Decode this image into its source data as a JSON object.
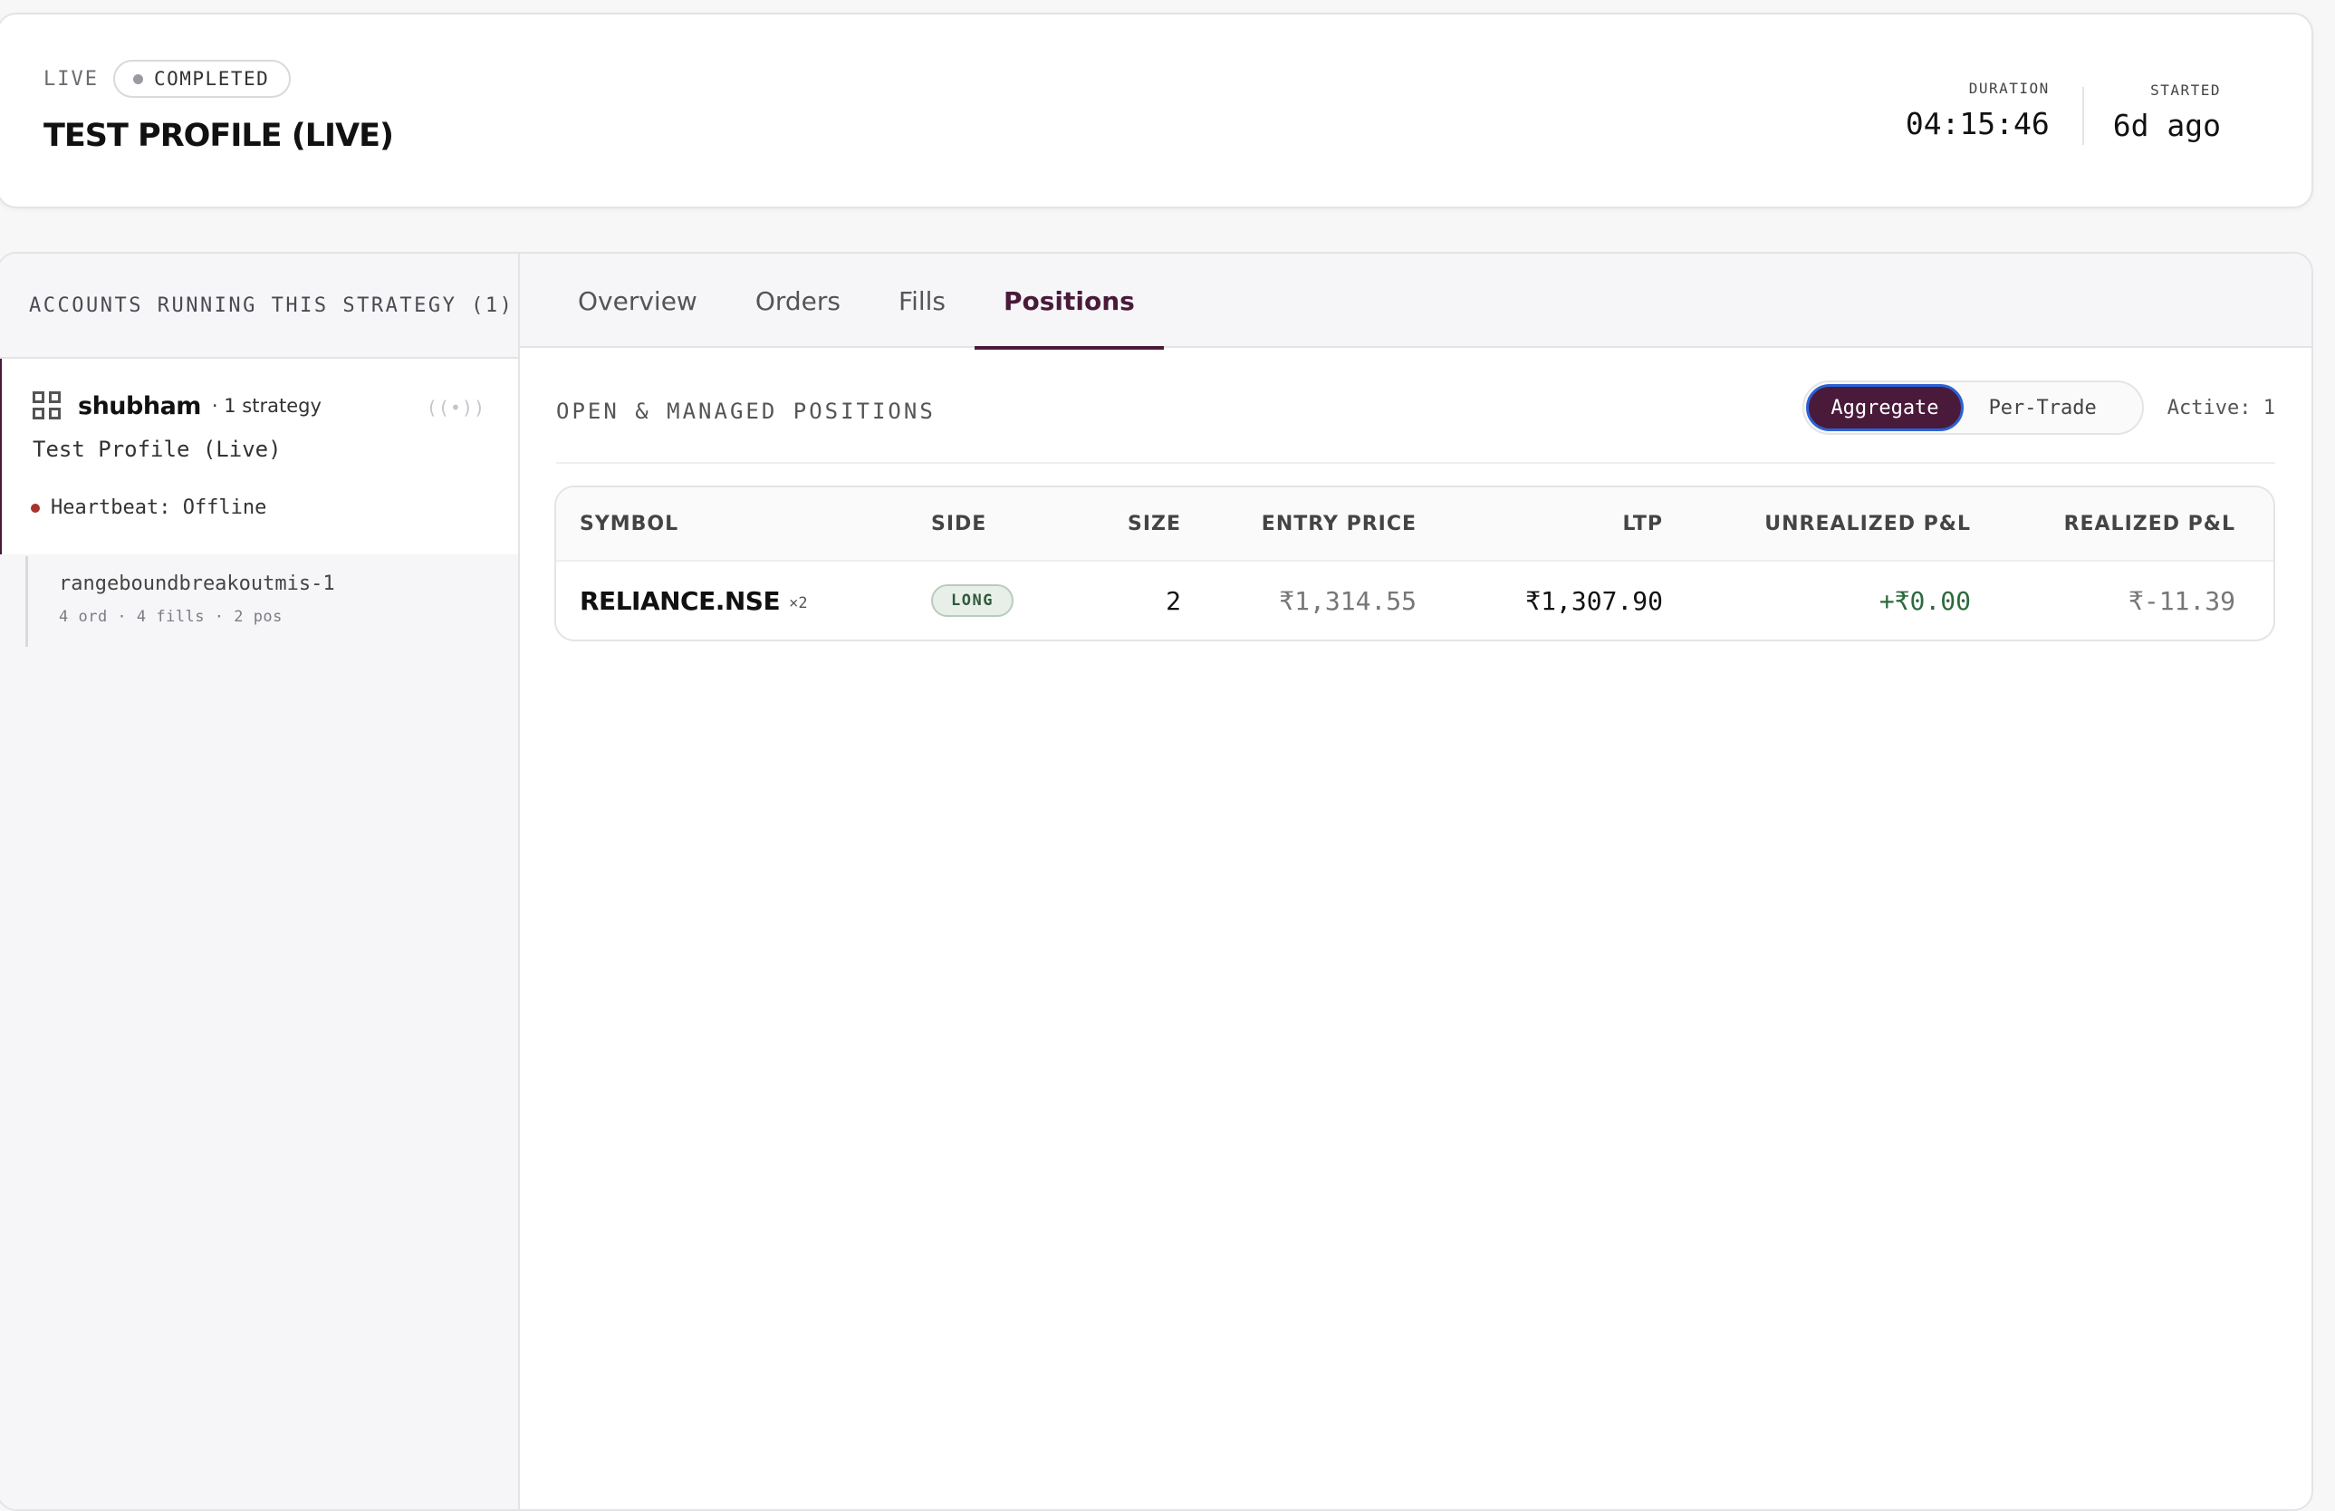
{
  "header": {
    "mode_label": "LIVE",
    "status_label": "COMPLETED",
    "profile_title": "TEST PROFILE (LIVE)",
    "duration_label": "DURATION",
    "duration_value": "04:15:46",
    "started_label": "STARTED",
    "started_value": "6d ago"
  },
  "sidebar": {
    "title": "ACCOUNTS RUNNING THIS STRATEGY (1)",
    "account": {
      "name": "shubham",
      "meta": "· 1 strategy",
      "broadcast_icon": "((•))",
      "profile": "Test Profile (Live)",
      "heartbeat": "Heartbeat: Offline"
    },
    "strategy": {
      "name": "rangeboundbreakoutmis-1",
      "stats": "4 ord · 4 fills · 2 pos"
    }
  },
  "tabs": [
    {
      "label": "Overview"
    },
    {
      "label": "Orders"
    },
    {
      "label": "Fills"
    },
    {
      "label": "Positions"
    }
  ],
  "positions": {
    "title": "OPEN & MANAGED POSITIONS",
    "toggle_aggregate": "Aggregate",
    "toggle_per_trade": "Per-Trade",
    "active_count": "Active: 1",
    "columns": {
      "symbol": "SYMBOL",
      "side": "SIDE",
      "size": "SIZE",
      "entry_price": "ENTRY PRICE",
      "ltp": "LTP",
      "unrealized": "UNREALIZED P&L",
      "realized": "REALIZED P&L"
    },
    "rows": [
      {
        "symbol": "RELIANCE.NSE",
        "multiplier": "×2",
        "side": "LONG",
        "size": "2",
        "entry_price": "₹1,314.55",
        "ltp": "₹1,307.90",
        "unrealized": "+₹0.00",
        "realized": "₹-11.39"
      }
    ]
  },
  "colors": {
    "accent": "#4a1a3a",
    "positive": "#2d6a3e",
    "offline": "#a8332a"
  }
}
